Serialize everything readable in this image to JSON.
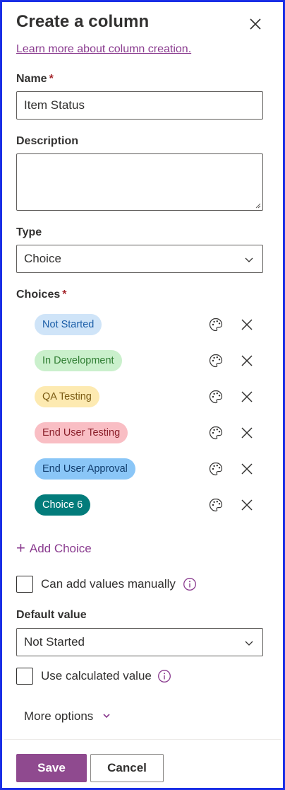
{
  "panel": {
    "title": "Create a column",
    "learn_more": "Learn more about column creation."
  },
  "name": {
    "label": "Name",
    "required_mark": "*",
    "value": "Item Status"
  },
  "description": {
    "label": "Description",
    "value": ""
  },
  "type": {
    "label": "Type",
    "value": "Choice"
  },
  "choices": {
    "label": "Choices",
    "required_mark": "*",
    "items": [
      {
        "label": "Not Started",
        "bg": "#cfe4f8",
        "fg": "#1b5ea8"
      },
      {
        "label": "In Development",
        "bg": "#caf0cc",
        "fg": "#2f7d32"
      },
      {
        "label": "QA Testing",
        "bg": "#fdeab1",
        "fg": "#7a5a12"
      },
      {
        "label": "End User Testing",
        "bg": "#f9bec4",
        "fg": "#8b1f2a"
      },
      {
        "label": "End User Approval",
        "bg": "#8ac6f7",
        "fg": "#123e6e"
      },
      {
        "label": "Choice 6",
        "bg": "#037c7b",
        "fg": "#ffffff"
      }
    ],
    "add_label": "Add Choice"
  },
  "manual_values": {
    "label": "Can add values manually",
    "checked": false
  },
  "default_value": {
    "label": "Default value",
    "value": "Not Started"
  },
  "calculated": {
    "label": "Use calculated value",
    "checked": false
  },
  "more_options": "More options",
  "footer": {
    "save": "Save",
    "cancel": "Cancel"
  },
  "colors": {
    "accent": "#8f4a8f",
    "link": "#8a3b8f",
    "frame": "#1a2ee6",
    "required": "#a4262c"
  }
}
